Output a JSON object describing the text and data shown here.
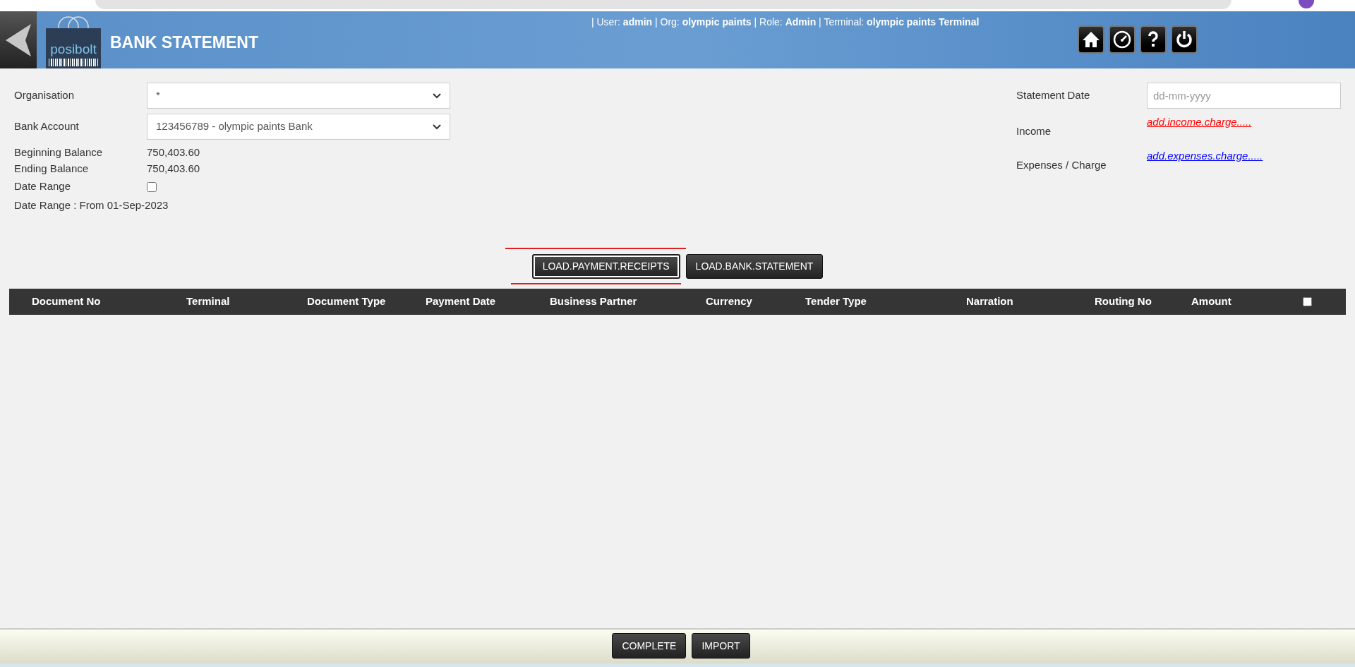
{
  "header": {
    "logo_text": "posibolt",
    "title": "BANK STATEMENT",
    "session_info": "| User: **admin** | Org: **olympic paints** | Role: **Admin** | Terminal: **olympic paints Terminal**"
  },
  "form_left": [
    {
      "kind": "select",
      "label": "Organisation",
      "value": "*"
    },
    {
      "kind": "select",
      "label": "Bank Account",
      "value": "123456789 - olympic paints Bank"
    },
    {
      "kind": "value",
      "label": "Beginning Balance",
      "value": "750,403.60"
    },
    {
      "kind": "value",
      "label": "Ending Balance",
      "value": "750,403.60"
    },
    {
      "kind": "checkbox",
      "label": "Date Range",
      "checked": false
    },
    {
      "kind": "note",
      "label": "Date Range : From 01-Sep-2023"
    }
  ],
  "form_right": {
    "statement_date": {
      "label": "Statement Date",
      "placeholder": "dd-mm-yyyy"
    },
    "income": {
      "label": "Income",
      "link": "add.income.charge.....",
      "color": "#ff0000"
    },
    "expenses": {
      "label": "Expenses / Charge",
      "link": "add.expenses.charge.....",
      "color": "#0000ff"
    }
  },
  "load_buttons": [
    {
      "label": "LOAD.PAYMENT.RECEIPTS",
      "focused": true
    },
    {
      "label": "LOAD.BANK.STATEMENT",
      "focused": false
    }
  ],
  "table": {
    "columns": [
      "Document No",
      "Terminal",
      "Document Type",
      "Payment Date",
      "Business Partner",
      "Currency",
      "Tender Type",
      "Narration",
      "Routing No",
      "Amount"
    ],
    "select_all_checked": false
  },
  "footer_buttons": [
    "COMPLETE",
    "IMPORT"
  ]
}
